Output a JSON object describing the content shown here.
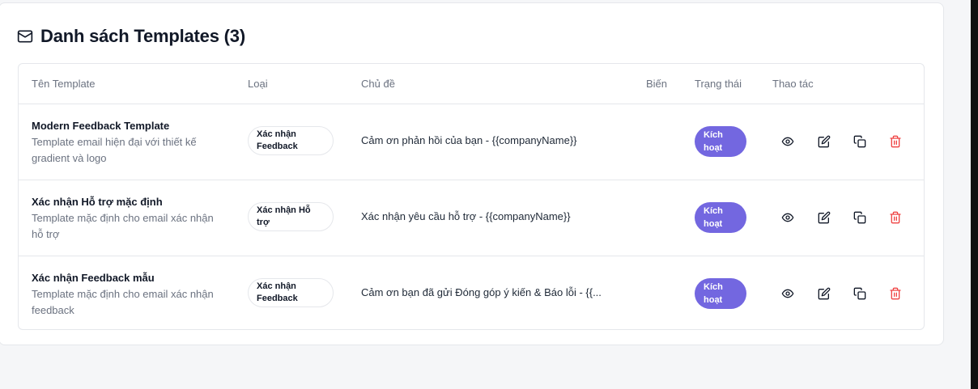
{
  "card": {
    "title": "Danh sách Templates (3)",
    "title_icon": "mail-icon"
  },
  "table": {
    "headers": {
      "name": "Tên Template",
      "type": "Loại",
      "subject": "Chủ đề",
      "variables": "Biến",
      "status": "Trạng thái",
      "actions": "Thao tác"
    },
    "rows": [
      {
        "name": "Modern Feedback Template",
        "description": "Template email hiện đại với thiết kế gradient và logo",
        "type": "Xác nhận Feedback",
        "subject": "Cảm ơn phản hồi của bạn - {{companyName}}",
        "status": "Kích hoạt"
      },
      {
        "name": "Xác nhận Hỗ trợ mặc định",
        "description": "Template mặc định cho email xác nhận hỗ trợ",
        "type": "Xác nhận Hỗ trợ",
        "subject": "Xác nhận yêu cầu hỗ trợ - {{companyName}}",
        "status": "Kích hoạt"
      },
      {
        "name": "Xác nhận Feedback mẫu",
        "description": "Template mặc định cho email xác nhận feedback",
        "type": "Xác nhận Feedback",
        "subject": "Cảm ơn bạn đã gửi Đóng góp ý kiến & Báo lỗi - {{...",
        "status": "Kích hoạt"
      }
    ],
    "row_actions": [
      "eye-icon",
      "edit-icon",
      "copy-icon",
      "trash-icon"
    ]
  },
  "colors": {
    "status_active": "#7367e0",
    "delete": "#ef4444",
    "muted_text": "#6b7280",
    "border": "#e5e7eb"
  }
}
